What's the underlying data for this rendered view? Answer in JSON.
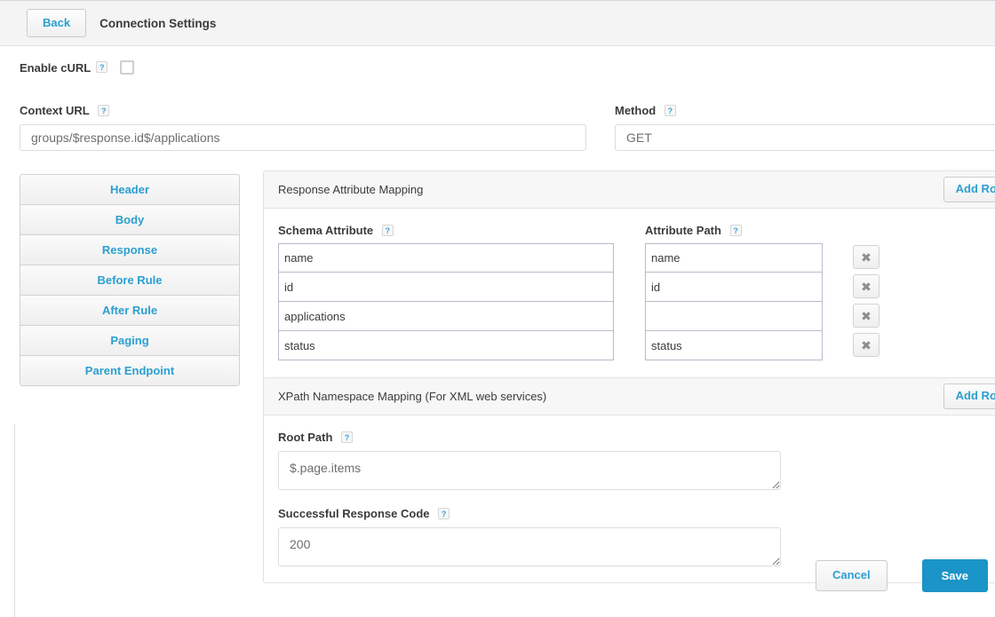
{
  "topbar": {
    "back_label": "Back",
    "title": "Connection Settings"
  },
  "form": {
    "enable_curl_label": "Enable cURL",
    "enable_curl_checked": false,
    "help_glyph": "?",
    "context_url_label": "Context URL",
    "context_url_value": "groups/$response.id$/applications",
    "method_label": "Method",
    "method_value": "GET"
  },
  "sidebar": {
    "items": [
      {
        "label": "Header"
      },
      {
        "label": "Body"
      },
      {
        "label": "Response"
      },
      {
        "label": "Before Rule"
      },
      {
        "label": "After Rule"
      },
      {
        "label": "Paging"
      },
      {
        "label": "Parent Endpoint"
      }
    ]
  },
  "response_mapping": {
    "panel_title": "Response Attribute Mapping",
    "add_row_label": "Add Row",
    "columns": {
      "schema_attribute": "Schema Attribute",
      "attribute_path": "Attribute Path"
    },
    "delete_glyph": "✖",
    "rows": [
      {
        "schema_attribute": "name",
        "attribute_path": "name"
      },
      {
        "schema_attribute": "id",
        "attribute_path": "id"
      },
      {
        "schema_attribute": "applications",
        "attribute_path": ""
      },
      {
        "schema_attribute": "status",
        "attribute_path": "status"
      }
    ]
  },
  "xpath_mapping": {
    "panel_title": "XPath Namespace Mapping (For XML web services)",
    "add_row_label": "Add Row",
    "root_path_label": "Root Path",
    "root_path_value": "$.page.items",
    "response_code_label": "Successful Response Code",
    "response_code_value": "200"
  },
  "footer": {
    "cancel_label": "Cancel",
    "save_label": "Save"
  },
  "colors": {
    "accent_link": "#2a9fd0",
    "primary_button": "#1b94c8",
    "panel_header_bg": "#f7f7f8",
    "topbar_bg": "#f4f4f5",
    "row_input_border": "#b9bacb"
  }
}
